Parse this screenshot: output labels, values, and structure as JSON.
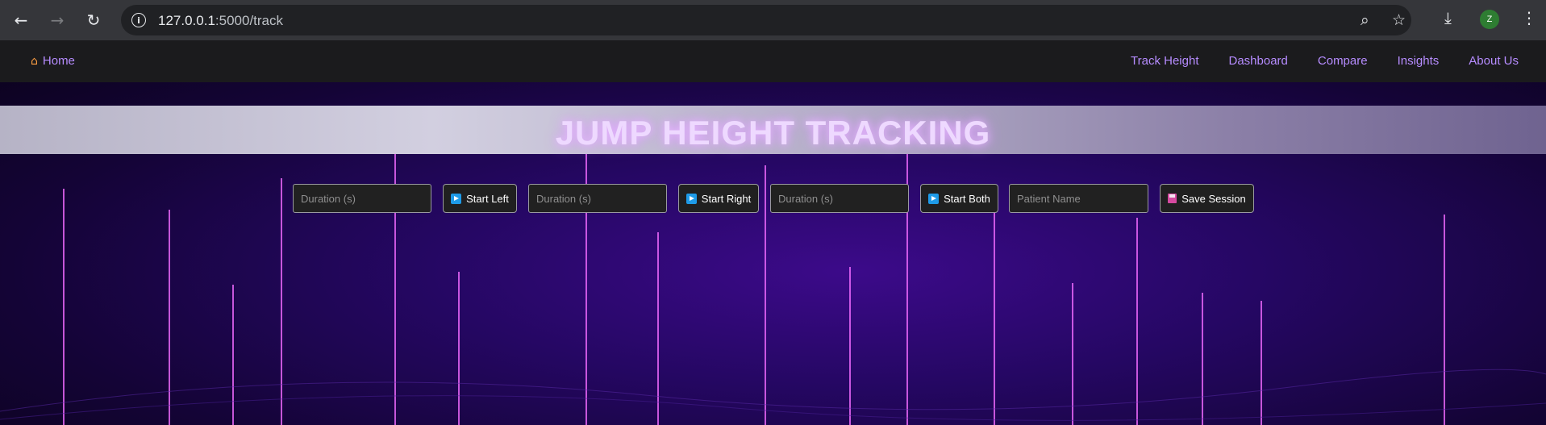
{
  "browser": {
    "url_host": "127.0.0.1",
    "url_port_path": ":5000/track",
    "avatar_letter": "Z",
    "icons": [
      "back-arrow-icon",
      "forward-arrow-icon",
      "reload-icon",
      "info-icon",
      "zoom-icon",
      "star-icon",
      "download-icon",
      "avatar",
      "menu-icon"
    ]
  },
  "navbar": {
    "home_label": "Home",
    "links": [
      "Track Height",
      "Dashboard",
      "Compare",
      "Insights",
      "About Us"
    ]
  },
  "banner": {
    "title": "JUMP HEIGHT TRACKING"
  },
  "controls": {
    "left_duration_placeholder": "Duration (s)",
    "start_left_label": "Start Left",
    "right_duration_placeholder": "Duration (s)",
    "start_right_label": "Start Right",
    "both_duration_placeholder": "Duration (s)",
    "start_both_label": "Start Both",
    "patient_name_placeholder": "Patient Name",
    "save_session_label": "Save Session"
  },
  "colors": {
    "accent_link": "#b68cff",
    "neon_line": "#d23cff",
    "background_deep": "#140436"
  }
}
